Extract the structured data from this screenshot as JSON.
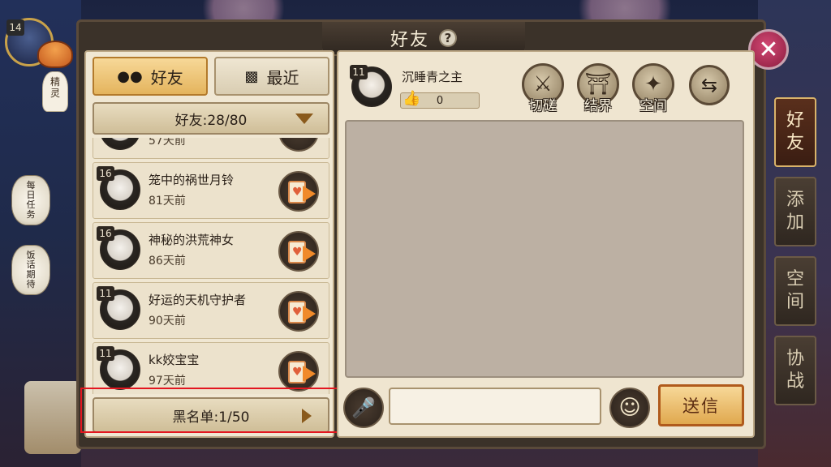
{
  "player": {
    "level": "14"
  },
  "left_tools": {
    "spirit_label": "精灵",
    "lantern1_label": "每日任务",
    "lantern2_label": "饭话期待"
  },
  "window": {
    "title": "好友",
    "help_icon": "?",
    "close_icon": "✕"
  },
  "tabs": [
    {
      "label": "好友",
      "active": true,
      "icon": "users-icon"
    },
    {
      "label": "最近",
      "active": false,
      "icon": "chat-icon"
    }
  ],
  "friend_group": {
    "label": "好友:28/80"
  },
  "friends": [
    {
      "level": "",
      "name": "",
      "time": "57天前"
    },
    {
      "level": "16",
      "name": "笼中的祸世月铃",
      "time": "81天前"
    },
    {
      "level": "16",
      "name": "神秘的洪荒神女",
      "time": "86天前"
    },
    {
      "level": "11",
      "name": "好运的天机守护者",
      "time": "90天前"
    },
    {
      "level": "11",
      "name": "kk姣宝宝",
      "time": "97天前"
    }
  ],
  "blacklist": {
    "label": "黑名单:1/50"
  },
  "chat": {
    "target_level": "11",
    "target_name": "沉睡青之主",
    "likes": "0",
    "actions": [
      {
        "label": "切磋",
        "icon": "⚔"
      },
      {
        "label": "结界",
        "icon": "⛩"
      },
      {
        "label": "空间",
        "icon": "✦"
      }
    ],
    "swap_icon": "⇆",
    "input_value": "",
    "mic_icon": "🎤",
    "emoji_icon": "☺",
    "send_label": "送信"
  },
  "side_tabs": [
    {
      "label": "好友",
      "active": true
    },
    {
      "label": "添加",
      "active": false
    },
    {
      "label": "空间",
      "active": false
    },
    {
      "label": "协战",
      "active": false
    }
  ]
}
